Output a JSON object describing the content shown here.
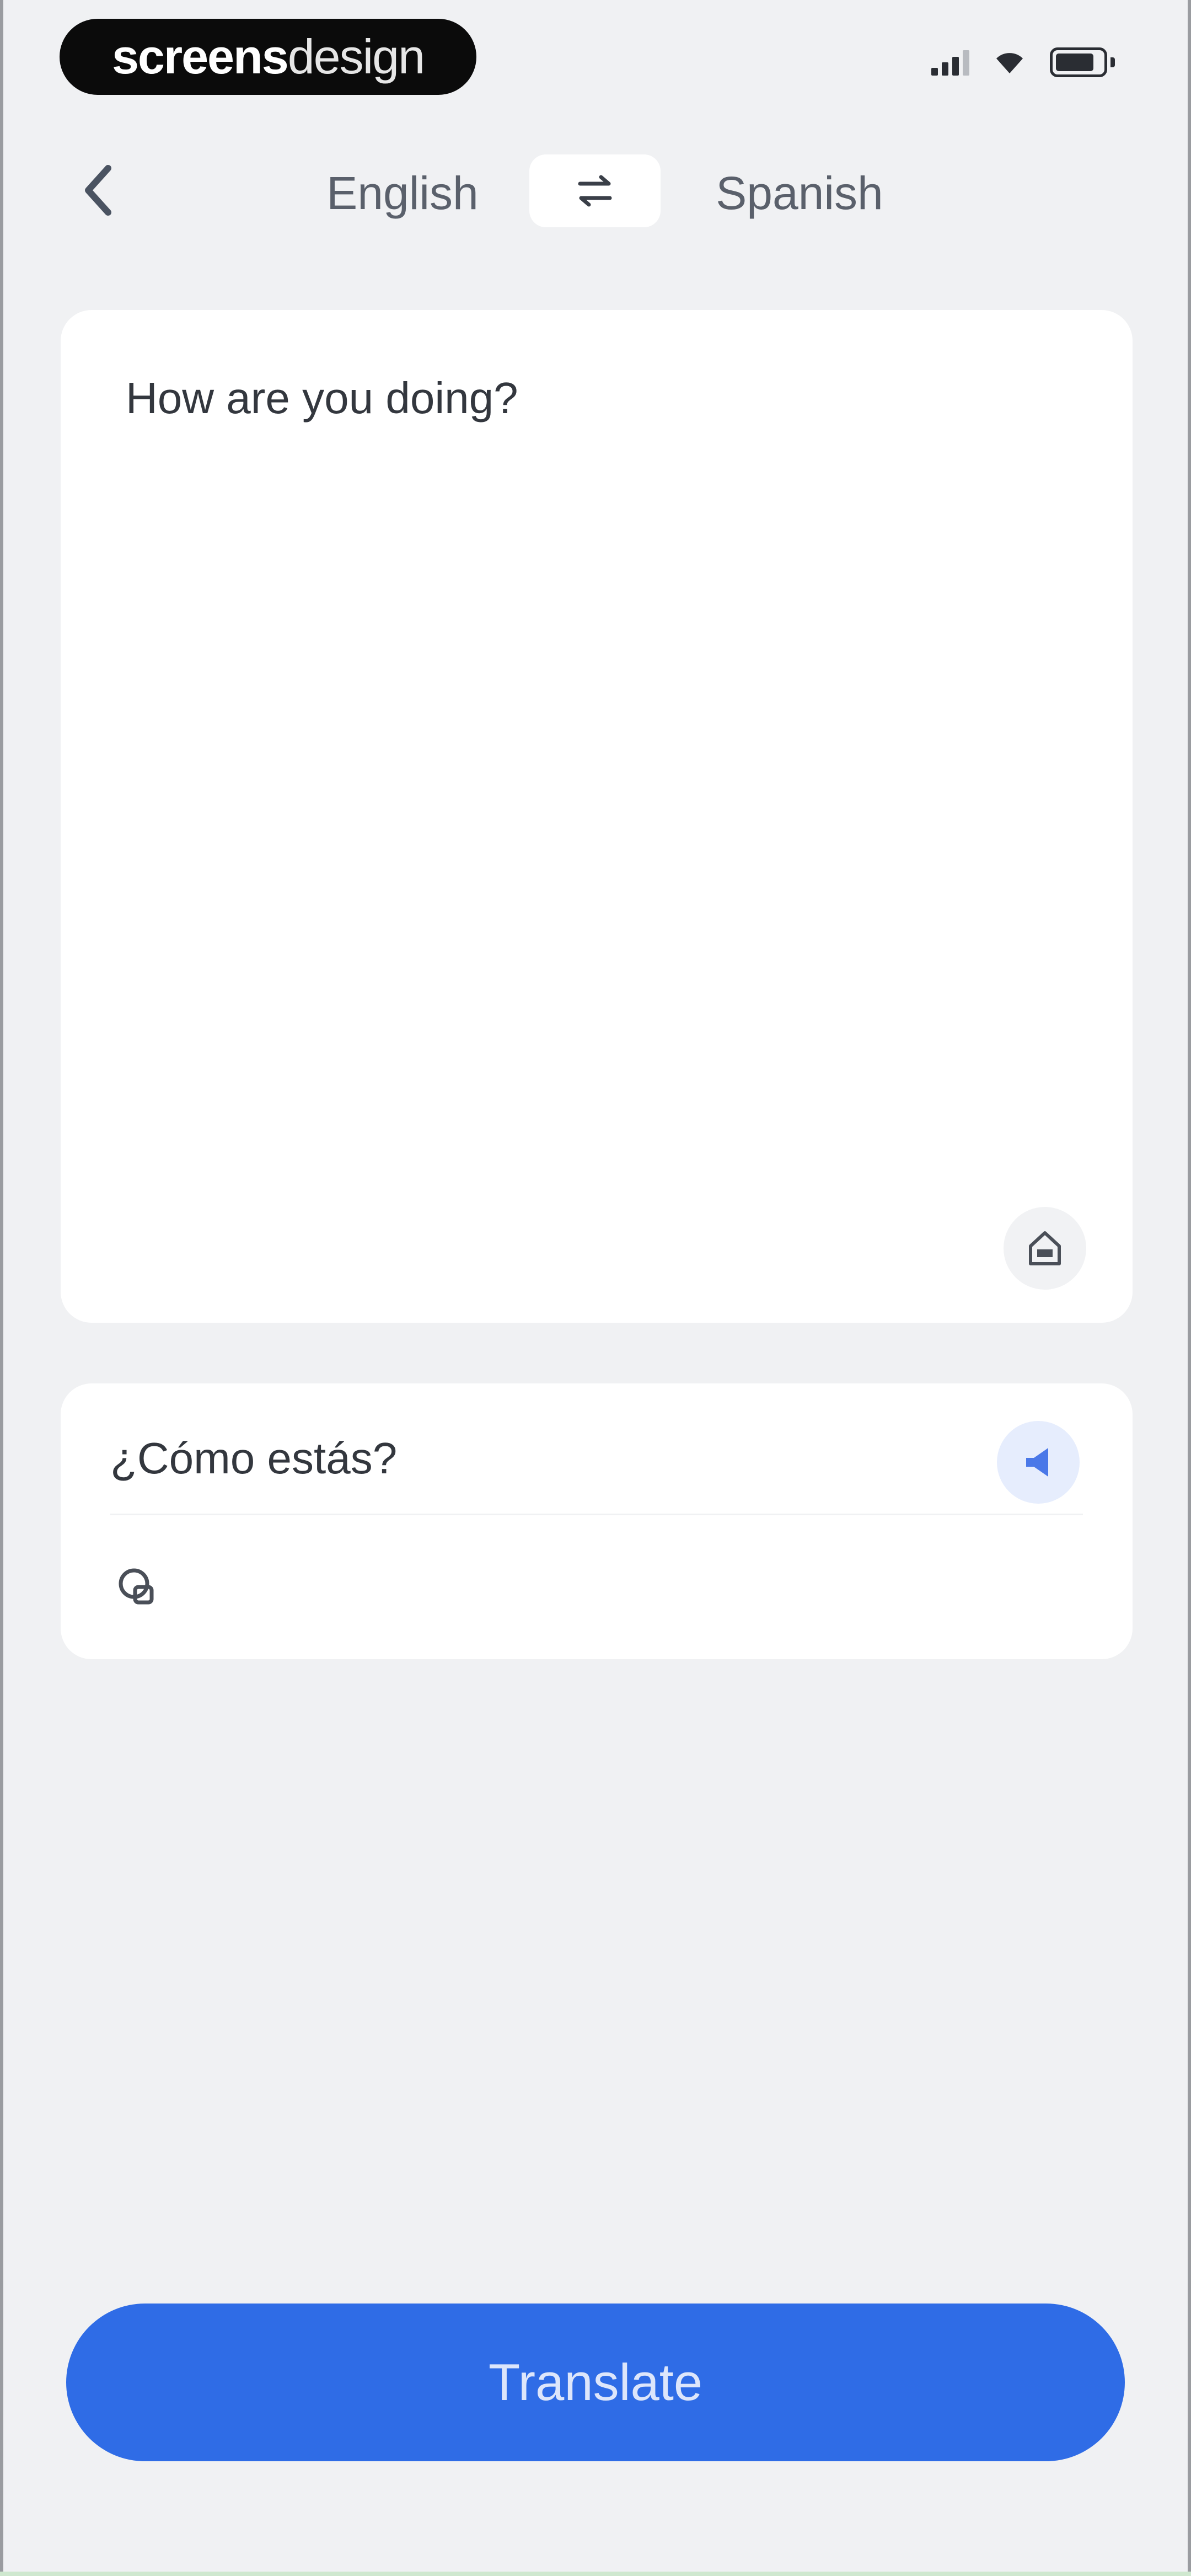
{
  "status_bar": {
    "brand_part1": "screens",
    "brand_part2": "design"
  },
  "header": {
    "source_language": "English",
    "target_language": "Spanish"
  },
  "input": {
    "text": "How are you doing?"
  },
  "output": {
    "text": "¿Cómo estás?"
  },
  "actions": {
    "translate_label": "Translate"
  },
  "colors": {
    "background": "#f0f1f3",
    "card": "#ffffff",
    "accent": "#2f6ce6",
    "text": "#33373e",
    "muted_text": "#5a606b"
  },
  "icons": {
    "back": "chevron-left-icon",
    "swap": "swap-arrows-icon",
    "camera_or_home": "home-outline-icon",
    "speaker": "speaker-icon",
    "copy": "copy-icon"
  }
}
